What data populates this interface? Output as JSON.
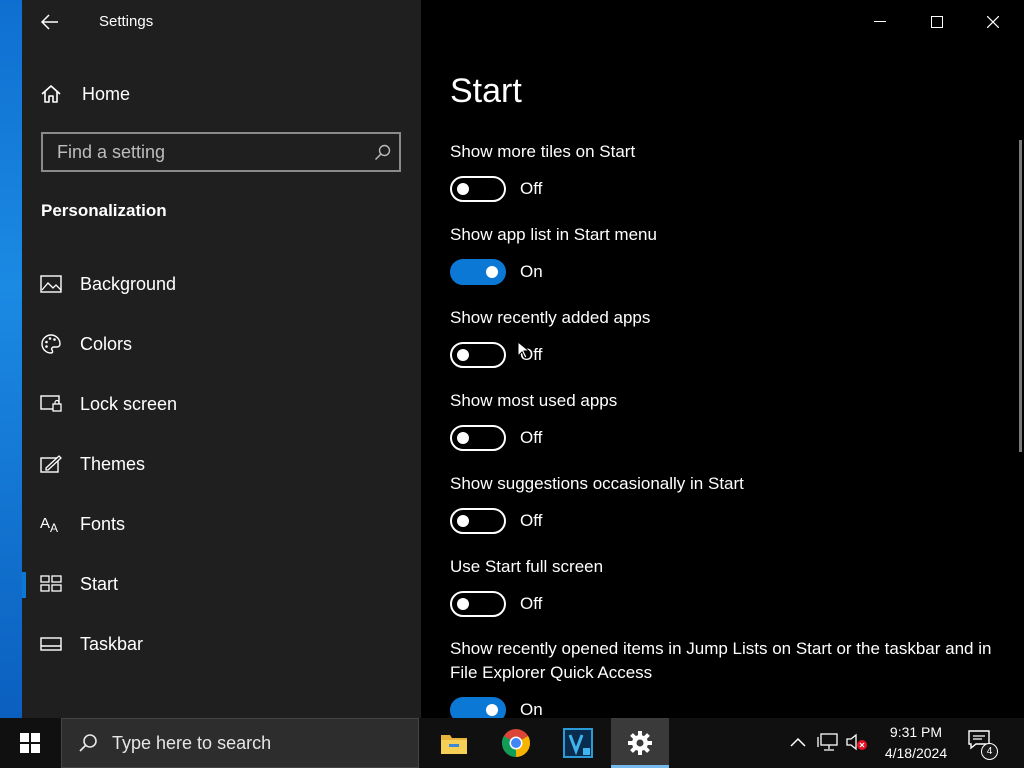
{
  "window": {
    "app_title": "Settings",
    "minimize_label": "",
    "maximize_label": "",
    "close_label": ""
  },
  "nav": {
    "home_label": "Home",
    "search_placeholder": "Find a setting",
    "section_title": "Personalization",
    "items": [
      {
        "label": "Background",
        "icon": "image-icon"
      },
      {
        "label": "Colors",
        "icon": "palette-icon"
      },
      {
        "label": "Lock screen",
        "icon": "lock-screen-icon"
      },
      {
        "label": "Themes",
        "icon": "themes-icon"
      },
      {
        "label": "Fonts",
        "icon": "fonts-icon"
      },
      {
        "label": "Start",
        "icon": "start-icon",
        "selected": true
      },
      {
        "label": "Taskbar",
        "icon": "taskbar-icon"
      }
    ]
  },
  "main": {
    "page_title": "Start",
    "settings": [
      {
        "label": "Show more tiles on Start",
        "state": "Off"
      },
      {
        "label": "Show app list in Start menu",
        "state": "On"
      },
      {
        "label": "Show recently added apps",
        "state": "Off"
      },
      {
        "label": "Show most used apps",
        "state": "Off"
      },
      {
        "label": "Show suggestions occasionally in Start",
        "state": "Off"
      },
      {
        "label": "Use Start full screen",
        "state": "Off"
      },
      {
        "label": "Show recently opened items in Jump Lists on Start or the taskbar and in File Explorer Quick Access",
        "state": "On"
      }
    ]
  },
  "taskbar": {
    "search_placeholder": "Type here to search",
    "apps": [
      "file-explorer-icon",
      "chrome-icon",
      "visual-studio-icon",
      "settings-gear-icon"
    ],
    "clock_time": "9:31 PM",
    "clock_date": "4/18/2024",
    "notification_count": "4"
  },
  "colors": {
    "accent": "#0a78d4",
    "nav_background": "#1f1f1f",
    "main_background": "#000000",
    "taskbar_background": "#101010"
  }
}
